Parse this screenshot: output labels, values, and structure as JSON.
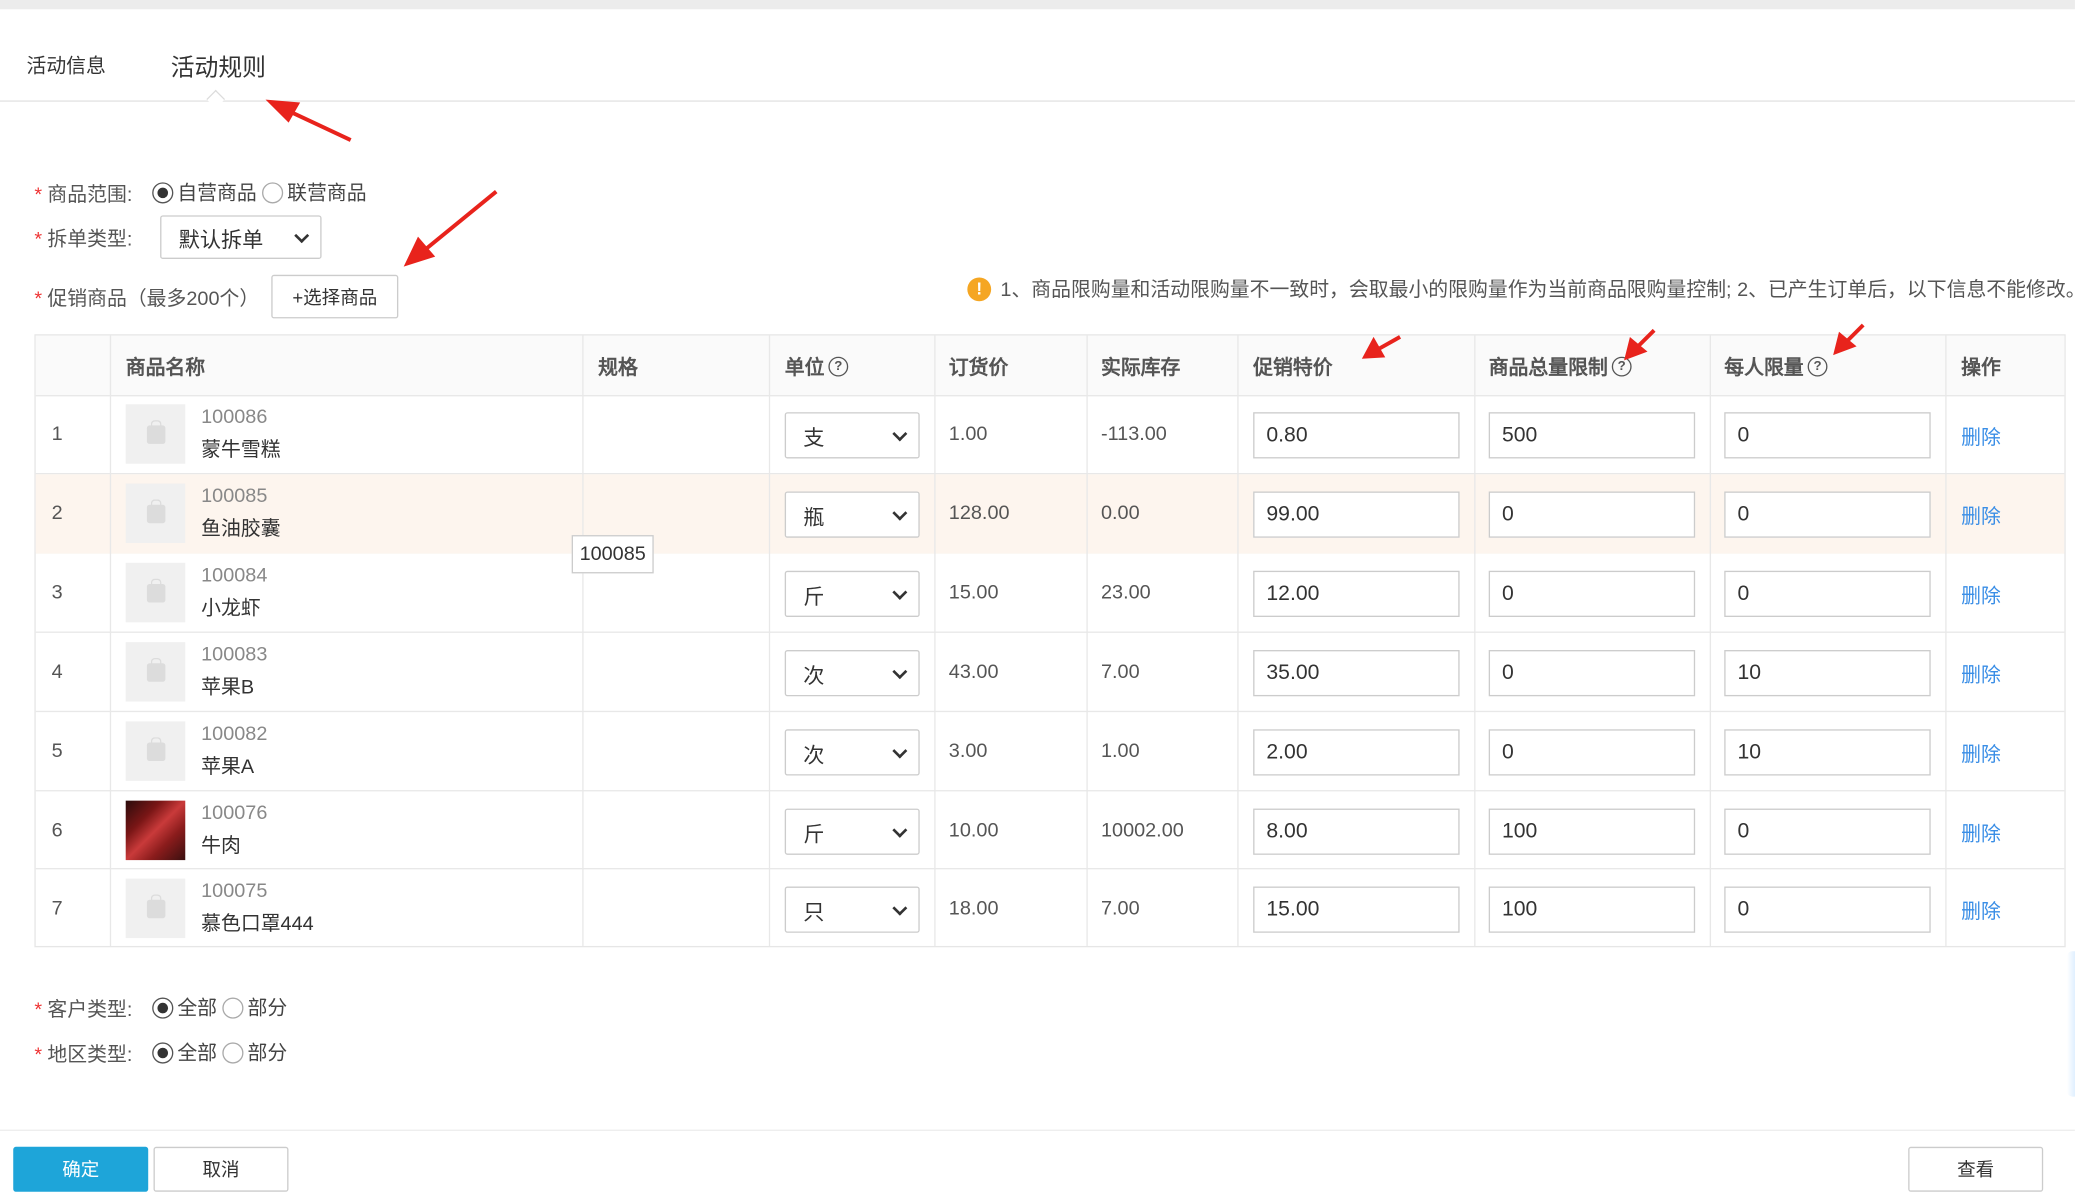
{
  "tabs": [
    {
      "label": "活动信息"
    },
    {
      "label": "活动规则"
    }
  ],
  "form": {
    "scope": {
      "label": "商品范围:",
      "options": [
        "自营商品",
        "联营商品"
      ],
      "selected": "自营商品"
    },
    "split": {
      "label": "拆单类型:",
      "value": "默认拆单"
    },
    "promo": {
      "label": "促销商品（最多200个）",
      "select_button": "+选择商品"
    },
    "notice": "1、商品限购量和活动限购量不一致时，会取最小的限购量作为当前商品限购量控制; 2、已产生订单后，以下信息不能修改。",
    "customer": {
      "label": "客户类型:",
      "options": [
        "全部",
        "部分"
      ],
      "selected": "全部"
    },
    "region": {
      "label": "地区类型:",
      "options": [
        "全部",
        "部分"
      ],
      "selected": "全部"
    }
  },
  "table": {
    "headers": {
      "name": "商品名称",
      "spec": "规格",
      "unit": "单位",
      "order_price": "订货价",
      "stock": "实际库存",
      "promo_price": "促销特价",
      "total_limit": "商品总量限制",
      "per_limit": "每人限量",
      "action": "操作"
    },
    "rows": [
      {
        "no": "1",
        "id": "100086",
        "name": "蒙牛雪糕",
        "unit": "支",
        "order_price": "1.00",
        "stock": "-113.00",
        "promo_price": "0.80",
        "total_limit": "500",
        "per_limit": "0",
        "action": "删除"
      },
      {
        "no": "2",
        "id": "100085",
        "name": "鱼油胶囊",
        "unit": "瓶",
        "order_price": "128.00",
        "stock": "0.00",
        "promo_price": "99.00",
        "total_limit": "0",
        "per_limit": "0",
        "action": "删除"
      },
      {
        "no": "3",
        "id": "100084",
        "name": "小龙虾",
        "unit": "斤",
        "order_price": "15.00",
        "stock": "23.00",
        "promo_price": "12.00",
        "total_limit": "0",
        "per_limit": "0",
        "action": "删除"
      },
      {
        "no": "4",
        "id": "100083",
        "name": "苹果B",
        "unit": "次",
        "order_price": "43.00",
        "stock": "7.00",
        "promo_price": "35.00",
        "total_limit": "0",
        "per_limit": "10",
        "action": "删除"
      },
      {
        "no": "5",
        "id": "100082",
        "name": "苹果A",
        "unit": "次",
        "order_price": "3.00",
        "stock": "1.00",
        "promo_price": "2.00",
        "total_limit": "0",
        "per_limit": "10",
        "action": "删除"
      },
      {
        "no": "6",
        "id": "100076",
        "name": "牛肉",
        "unit": "斤",
        "order_price": "10.00",
        "stock": "10002.00",
        "promo_price": "8.00",
        "total_limit": "100",
        "per_limit": "0",
        "action": "删除"
      },
      {
        "no": "7",
        "id": "100075",
        "name": "慕色口罩444",
        "unit": "只",
        "order_price": "18.00",
        "stock": "7.00",
        "promo_price": "15.00",
        "total_limit": "100",
        "per_limit": "0",
        "action": "删除"
      }
    ],
    "tooltip": "100085"
  },
  "footer": {
    "confirm": "确定",
    "cancel": "取消",
    "view": "查看"
  },
  "colors": {
    "primary": "#1ea5d9",
    "link": "#3a8ee6",
    "annotation_arrow": "#e8231c",
    "row_highlight": "#fdf5ee",
    "warning": "#f5a623"
  }
}
